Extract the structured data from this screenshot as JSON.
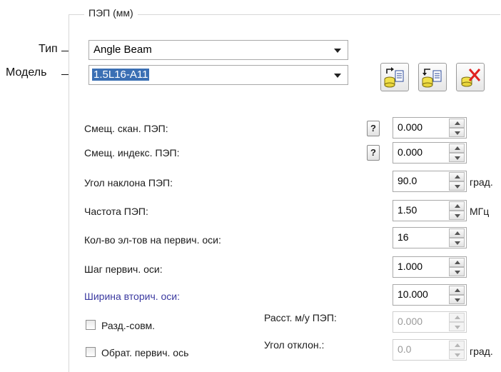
{
  "group": {
    "title": "ПЭП (мм)"
  },
  "callouts": {
    "type": "Тип",
    "model": "Модель"
  },
  "type_combo": {
    "value": "Angle Beam"
  },
  "model_combo": {
    "value": "1.5L16-A11"
  },
  "toolbar": {
    "icons": [
      "db-import-icon",
      "db-export-icon",
      "db-delete-icon"
    ],
    "delete_color": "#e02020"
  },
  "fields": [
    {
      "label": "Смещ. скан. ПЭП:",
      "value": "0.000",
      "help": "?",
      "unit": ""
    },
    {
      "label": "Смещ. индекс. ПЭП:",
      "value": "0.000",
      "help": "?",
      "unit": ""
    },
    {
      "label": "Угол наклона ПЭП:",
      "value": "90.0",
      "help": "",
      "unit": "град."
    },
    {
      "label": "Частота ПЭП:",
      "value": "1.50",
      "help": "",
      "unit": "МГц"
    },
    {
      "label": "Кол-во эл-тов на первич. оси:",
      "value": "16",
      "help": "",
      "unit": ""
    },
    {
      "label": "Шаг первич. оси:",
      "value": "1.000",
      "help": "",
      "unit": ""
    },
    {
      "label": "Ширина вторич. оси:",
      "value": "10.000",
      "help": "",
      "unit": ""
    }
  ],
  "options": {
    "pitch_catch": {
      "label": "Разд.-совм.",
      "checked": false
    },
    "reverse_primary": {
      "label": "Обрат. первич. ось",
      "checked": false
    },
    "probe_separation": {
      "label": "Расст. м/у ПЭП:",
      "value": "0.000",
      "disabled": true
    },
    "skew_angle": {
      "label": "Угол отклон.:",
      "value": "0.0",
      "unit": "град.",
      "disabled": true
    }
  },
  "colors": {
    "selection": "#3a6fb4",
    "blue_label": "#3b3aa0"
  }
}
